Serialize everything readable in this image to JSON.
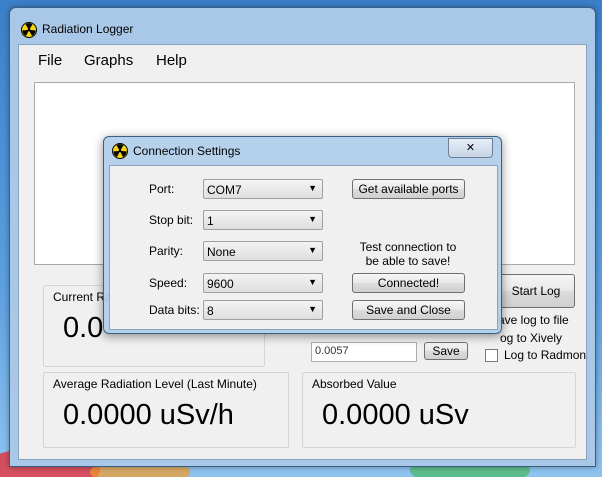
{
  "window": {
    "title": "Radiation Logger"
  },
  "menu": [
    {
      "label": "File"
    },
    {
      "label": "Graphs"
    },
    {
      "label": "Help"
    }
  ],
  "current_radiation": {
    "label": "Current Ra",
    "value": "0.0"
  },
  "controls": {
    "start_log_label": "Start Log",
    "save_log_to_file_label": "ave log to file",
    "log_to_xively_label": "og to Xively",
    "log_to_radmon_label": "Log to Radmon",
    "small_value": "0.0057",
    "save_label": "Save"
  },
  "average_radiation": {
    "label": "Average Radiation Level (Last Minute)",
    "value": "0.0000 uSv/h"
  },
  "absorbed": {
    "label": "Absorbed Value",
    "value": "0.0000 uSv"
  },
  "dialog": {
    "title": "Connection Settings",
    "close_symbol": "✕",
    "port": {
      "label": "Port:",
      "value": "COM7"
    },
    "stop_bit": {
      "label": "Stop bit:",
      "value": "1"
    },
    "parity": {
      "label": "Parity:",
      "value": "None"
    },
    "speed": {
      "label": "Speed:",
      "value": "9600"
    },
    "data_bits": {
      "label": "Data bits:",
      "value": "8"
    },
    "get_ports_label": "Get available ports",
    "note_line1": "Test connection to",
    "note_line2": "be able to save!",
    "connected_label": "Connected!",
    "save_close_label": "Save and Close"
  },
  "icons": {
    "app": "radiation-icon",
    "dropdown": "chevron-down-icon"
  },
  "colors": {
    "desktop": "#3b7fc9",
    "frame": "#a9c8e8",
    "client": "#f0f0f0",
    "radiation_yellow": "#f5d316"
  }
}
